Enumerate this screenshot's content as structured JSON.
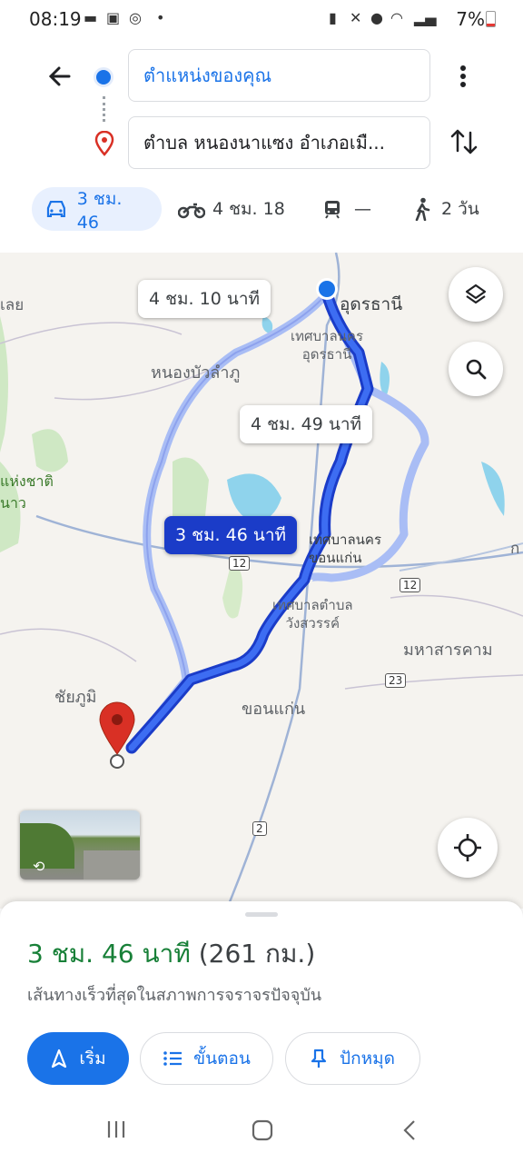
{
  "status_bar": {
    "time": "08:19",
    "battery": "7%"
  },
  "route": {
    "origin": "ตำแหน่งของคุณ",
    "destination": "ตำบล หนองนาแซง อำเภอเมื..."
  },
  "modes": [
    {
      "icon": "car-icon",
      "label": "3 ชม. 46",
      "selected": true
    },
    {
      "icon": "motorcycle-icon",
      "label": "4 ชม. 18"
    },
    {
      "icon": "transit-icon",
      "label": "—"
    },
    {
      "icon": "walk-icon",
      "label": "2 วัน"
    }
  ],
  "map": {
    "places": {
      "loei": "เลย",
      "udon_thani": "อุดรธานี",
      "udon_muni": "เทศบาลนคร\nอุดรธานี",
      "nong_bua": "หนองบัวลำภู",
      "national_park": "แห่งชาติ\nนาว",
      "khon_kaen_muni": "เทศบาลนคร\nขอนแก่น",
      "wang_sawang": "เทศบาลตำบล\nวังสวรรค์",
      "maha_sarakham": "มหาสารคาม",
      "chaiyaphum": "ชัยภูมิ",
      "khon_kaen": "ขอนแก่น",
      "edge_k": "ก"
    },
    "route_labels": {
      "alt1": "4 ชม. 10 นาที",
      "alt2": "4 ชม. 49 นาที",
      "selected": "3 ชม. 46 นาที"
    },
    "shields": [
      "12",
      "12",
      "23",
      "2"
    ],
    "colors": {
      "route": "#1a3fe0",
      "alt": "#a9bdf5",
      "pin": "#d93025"
    }
  },
  "sheet": {
    "duration": "3 ชม. 46 นาที",
    "distance": "(261 กม.)",
    "subtitle": "เส้นทางเร็วที่สุดในสภาพการจราจรปัจจุบัน",
    "start": "เริ่ม",
    "steps": "ขั้นตอน",
    "pin": "ปักหมุด"
  }
}
